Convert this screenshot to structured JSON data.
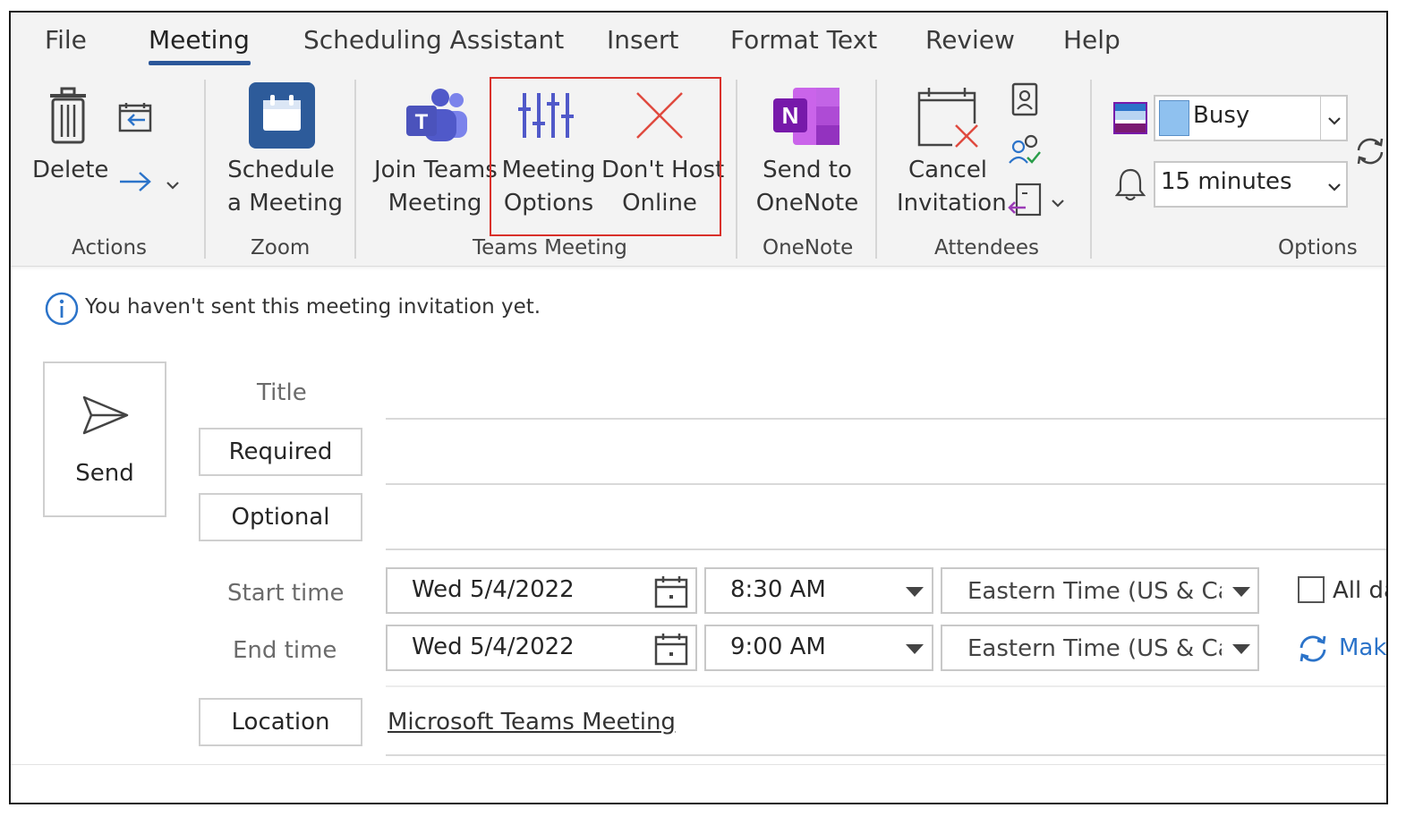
{
  "ribbon_tabs": [
    "File",
    "Meeting",
    "Scheduling Assistant",
    "Insert",
    "Format Text",
    "Review",
    "Help"
  ],
  "active_tab": "Meeting",
  "groups": {
    "actions": {
      "label": "Actions",
      "delete_label": "Delete"
    },
    "zoom": {
      "label": "Zoom",
      "schedule_line1": "Schedule",
      "schedule_line2": "a Meeting"
    },
    "teams": {
      "label": "Teams Meeting",
      "join_line1": "Join Teams",
      "join_line2": "Meeting",
      "options_line1": "Meeting",
      "options_line2": "Options",
      "donthost_line1": "Don't Host",
      "donthost_line2": "Online"
    },
    "onenote": {
      "label": "OneNote",
      "send_line1": "Send to",
      "send_line2": "OneNote"
    },
    "attendees": {
      "label": "Attendees",
      "cancel_line1": "Cancel",
      "cancel_line2": "Invitation"
    },
    "options": {
      "label": "Options",
      "show_as": "Busy",
      "reminder": "15 minutes"
    }
  },
  "colors": {
    "highlight_border": "#d9302a",
    "tab_underline": "#2b579a",
    "zoom_blue": "#2d5b9a",
    "teams_purple": "#5059c9",
    "onenote_purple": "#7719aa",
    "busy_blue": "#8fc1ef",
    "link_blue": "#2b73c9"
  },
  "info": {
    "message": "You haven't sent this meeting invitation yet."
  },
  "form": {
    "send_label": "Send",
    "title_label": "Title",
    "required_label": "Required",
    "optional_label": "Optional",
    "start_label": "Start time",
    "end_label": "End time",
    "location_label": "Location",
    "start_date": "Wed 5/4/2022",
    "start_time": "8:30 AM",
    "end_date": "Wed 5/4/2022",
    "end_time": "9:00 AM",
    "timezone_start": "Eastern Time (US & Canada)",
    "timezone_end": "Eastern Time (US & Canada)",
    "all_day_label": "All day",
    "recurring_label": "Make Recurring",
    "location_value": "Microsoft Teams Meeting"
  }
}
